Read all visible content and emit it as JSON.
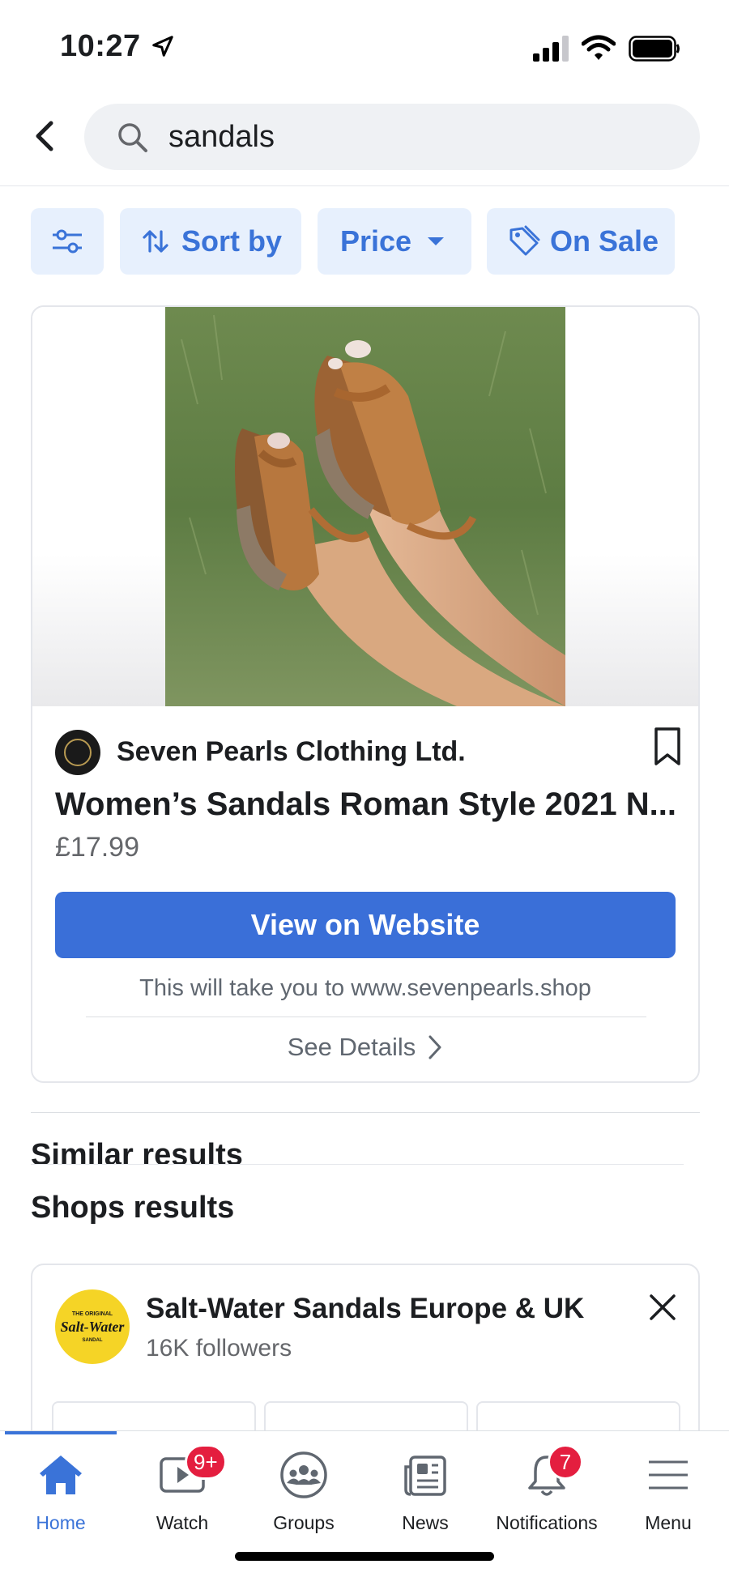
{
  "status_bar": {
    "time": "10:27"
  },
  "search": {
    "query": "sandals"
  },
  "filters": {
    "sort_label": "Sort by",
    "price_label": "Price",
    "on_sale_label": "On Sale"
  },
  "product": {
    "seller": "Seven Pearls Clothing Ltd.",
    "title": "Women’s Sandals Roman Style 2021 N...",
    "price": "£17.99",
    "cta_label": "View on Website",
    "redirect_note": "This will take you to www.sevenpearls.shop",
    "details_label": "See Details"
  },
  "sections": {
    "similar_title": "Similar results",
    "shops_title": "Shops results"
  },
  "shop": {
    "name": "Salt-Water Sandals Europe & UK",
    "followers": "16K followers",
    "logo_text_top": "THE ORIGINAL",
    "logo_text_main": "Salt-Water",
    "logo_text_bottom": "SANDAL"
  },
  "tabs": [
    {
      "label": "Home",
      "icon": "home-icon",
      "active": true
    },
    {
      "label": "Watch",
      "icon": "watch-icon",
      "badge": "9+"
    },
    {
      "label": "Groups",
      "icon": "groups-icon"
    },
    {
      "label": "News",
      "icon": "news-icon"
    },
    {
      "label": "Notifications",
      "icon": "bell-icon",
      "badge": "7"
    },
    {
      "label": "Menu",
      "icon": "menu-icon"
    }
  ],
  "colors": {
    "accent": "#3a73d8",
    "cta": "#3a6fd8",
    "chip_bg": "#e7f0fd",
    "badge": "#e41e3f"
  }
}
